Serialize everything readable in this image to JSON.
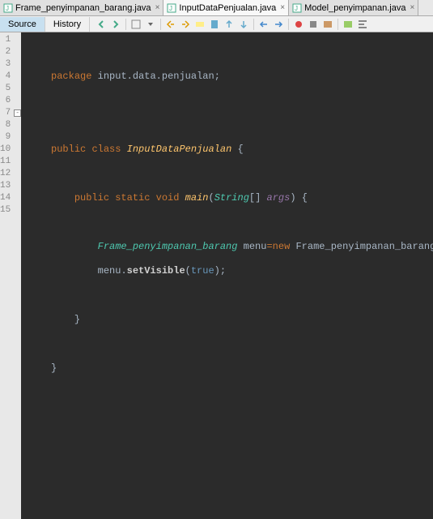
{
  "tabs": [
    {
      "label": "Frame_penyimpanan_barang.java",
      "active": false
    },
    {
      "label": "InputDataPenjualan.java",
      "active": true
    },
    {
      "label": "Model_penyimpanan.java",
      "active": false
    }
  ],
  "subtabs": [
    {
      "label": "Source",
      "active": true
    },
    {
      "label": "History",
      "active": false
    }
  ],
  "gutter_lines": [
    "1",
    "2",
    "3",
    "4",
    "5",
    "6",
    "7",
    "8",
    "9",
    "10",
    "11",
    "12",
    "13",
    "14",
    "15"
  ],
  "fold_markers": {
    "7": "-"
  },
  "code": {
    "l2": {
      "kw": "package",
      "pkg1": "input",
      "dot1": ".",
      "pkg2": "data",
      "dot2": ".",
      "pkg3": "penjualan",
      "semi": ";"
    },
    "l5": {
      "kw1": "public",
      "kw2": "class",
      "cls": "InputDataPenjualan",
      "brace": "{"
    },
    "l7": {
      "kw1": "public",
      "kw2": "static",
      "kw3": "void",
      "mth": "main",
      "lp": "(",
      "typ": "String",
      "arr": "[]",
      "arg": "args",
      "rp": ")",
      "brace": "{"
    },
    "l9": {
      "typ": "Frame_penyimpanan_barang",
      "var": "menu",
      "op": "=",
      "kw": "new",
      "ctor": "Frame_penyimpanan_barang",
      "call": "();"
    },
    "l10": {
      "var": "menu",
      "dot": ".",
      "mth": "setVisible",
      "lp": "(",
      "val": "true",
      "rp": ");"
    },
    "l12": {
      "brace": "}"
    },
    "l14": {
      "brace": "}"
    }
  },
  "icons": {
    "java": "☕"
  }
}
